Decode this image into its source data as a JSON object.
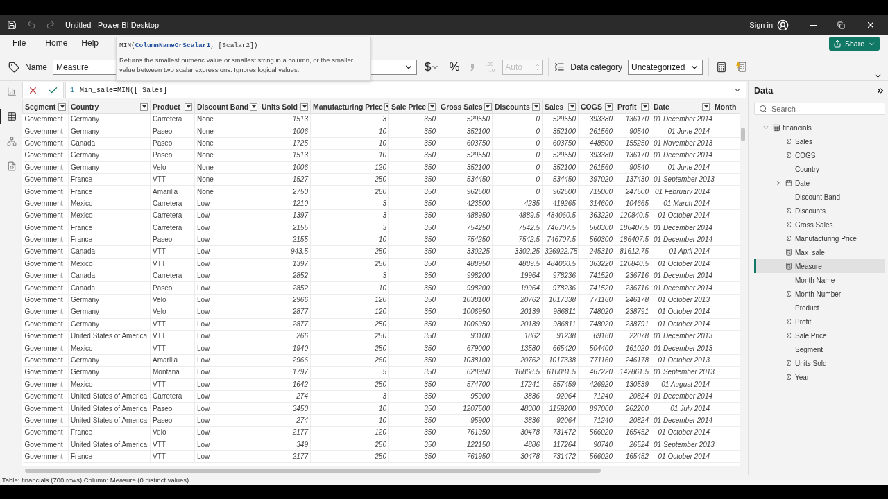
{
  "window": {
    "title": "Untitled - Power BI Desktop",
    "sign_in": "Sign in"
  },
  "ribbon_tabs": [
    {
      "label": "File",
      "selected": false
    },
    {
      "label": "Home",
      "selected": false
    },
    {
      "label": "Help",
      "selected": false
    }
  ],
  "share_button": "Share",
  "tooltip": {
    "signature": "MIN(**ColumnNameOrScalar1**, [Scalar2])",
    "description": "Returns the smallest numeric value or smallest string in a column, or the smaller value between two scalar expressions. Ignores logical values."
  },
  "toolbar": {
    "name_label": "Name",
    "name_value": "Measure",
    "format_buttons": [
      {
        "kind": "currency",
        "label": "$",
        "disabled": false
      },
      {
        "kind": "percent",
        "label": "%",
        "disabled": false
      },
      {
        "kind": "comma",
        "disabled": true
      },
      {
        "kind": "decimals",
        "label_top": ".00",
        "label_bottom": "→.0",
        "disabled": true
      }
    ],
    "decimal_places": {
      "value": "Auto",
      "disabled": true
    },
    "data_category_label": "Data category",
    "data_category_value": "Uncategorized"
  },
  "formula_bar": {
    "line_number": "1",
    "expression": "Min_sale=MIN([ Sales]"
  },
  "left_rail": [
    {
      "kind": "report",
      "selected": false
    },
    {
      "kind": "table",
      "selected": true
    },
    {
      "kind": "model",
      "selected": false
    },
    {
      "kind": "dax",
      "selected": false
    }
  ],
  "table": {
    "columns": [
      {
        "label": "Segment",
        "kind": "text"
      },
      {
        "label": "Country",
        "kind": "text"
      },
      {
        "label": "Product",
        "kind": "text"
      },
      {
        "label": "Discount Band",
        "kind": "text"
      },
      {
        "label": "Units Sold",
        "kind": "number"
      },
      {
        "label": "Manufacturing Price",
        "kind": "number"
      },
      {
        "label": "Sale Price",
        "kind": "number"
      },
      {
        "label": "Gross Sales",
        "kind": "number"
      },
      {
        "label": "Discounts",
        "kind": "number"
      },
      {
        "label": "Sales",
        "kind": "number"
      },
      {
        "label": "COGS",
        "kind": "number"
      },
      {
        "label": "Profit",
        "kind": "number"
      },
      {
        "label": "Date",
        "kind": "number"
      },
      {
        "label": "Month",
        "kind": "text"
      }
    ],
    "rows": [
      [
        "Government",
        "Germany",
        "Carretera",
        "None",
        "1513",
        "3",
        "350",
        "529550",
        "0",
        "529550",
        "393380",
        "136170",
        "01 December 2014"
      ],
      [
        "Government",
        "Germany",
        "Paseo",
        "None",
        "1006",
        "10",
        "350",
        "352100",
        "0",
        "352100",
        "261560",
        "90540",
        "01 June 2014"
      ],
      [
        "Government",
        "Canada",
        "Paseo",
        "None",
        "1725",
        "10",
        "350",
        "603750",
        "0",
        "603750",
        "448500",
        "155250",
        "01 November 2013"
      ],
      [
        "Government",
        "Germany",
        "Paseo",
        "None",
        "1513",
        "10",
        "350",
        "529550",
        "0",
        "529550",
        "393380",
        "136170",
        "01 December 2014"
      ],
      [
        "Government",
        "Germany",
        "Velo",
        "None",
        "1006",
        "120",
        "350",
        "352100",
        "0",
        "352100",
        "261560",
        "90540",
        "01 June 2014"
      ],
      [
        "Government",
        "France",
        "VTT",
        "None",
        "1527",
        "250",
        "350",
        "534450",
        "0",
        "534450",
        "397020",
        "137430",
        "01 September 2013"
      ],
      [
        "Government",
        "France",
        "Amarilla",
        "None",
        "2750",
        "260",
        "350",
        "962500",
        "0",
        "962500",
        "715000",
        "247500",
        "01 February 2014"
      ],
      [
        "Government",
        "Mexico",
        "Carretera",
        "Low",
        "1210",
        "3",
        "350",
        "423500",
        "4235",
        "419265",
        "314600",
        "104665",
        "01 March 2014"
      ],
      [
        "Government",
        "Mexico",
        "Carretera",
        "Low",
        "1397",
        "3",
        "350",
        "488950",
        "4889.5",
        "484060.5",
        "363220",
        "120840.5",
        "01 October 2014"
      ],
      [
        "Government",
        "France",
        "Carretera",
        "Low",
        "2155",
        "3",
        "350",
        "754250",
        "7542.5",
        "746707.5",
        "560300",
        "186407.5",
        "01 December 2014"
      ],
      [
        "Government",
        "France",
        "Paseo",
        "Low",
        "2155",
        "10",
        "350",
        "754250",
        "7542.5",
        "746707.5",
        "560300",
        "186407.5",
        "01 December 2014"
      ],
      [
        "Government",
        "Canada",
        "VTT",
        "Low",
        "943.5",
        "250",
        "350",
        "330225",
        "3302.25",
        "326922.75",
        "245310",
        "81612.75",
        "01 April 2014"
      ],
      [
        "Government",
        "Mexico",
        "VTT",
        "Low",
        "1397",
        "250",
        "350",
        "488950",
        "4889.5",
        "484060.5",
        "363220",
        "120840.5",
        "01 October 2014"
      ],
      [
        "Government",
        "Canada",
        "Carretera",
        "Low",
        "2852",
        "3",
        "350",
        "998200",
        "19964",
        "978236",
        "741520",
        "236716",
        "01 December 2014"
      ],
      [
        "Government",
        "Canada",
        "Paseo",
        "Low",
        "2852",
        "10",
        "350",
        "998200",
        "19964",
        "978236",
        "741520",
        "236716",
        "01 December 2014"
      ],
      [
        "Government",
        "Germany",
        "Velo",
        "Low",
        "2966",
        "120",
        "350",
        "1038100",
        "20762",
        "1017338",
        "771160",
        "246178",
        "01 October 2013"
      ],
      [
        "Government",
        "Germany",
        "Velo",
        "Low",
        "2877",
        "120",
        "350",
        "1006950",
        "20139",
        "986811",
        "748020",
        "238791",
        "01 October 2014"
      ],
      [
        "Government",
        "Germany",
        "VTT",
        "Low",
        "2877",
        "250",
        "350",
        "1006950",
        "20139",
        "986811",
        "748020",
        "238791",
        "01 October 2014"
      ],
      [
        "Government",
        "United States of America",
        "VTT",
        "Low",
        "266",
        "250",
        "350",
        "93100",
        "1862",
        "91238",
        "69160",
        "22078",
        "01 December 2013"
      ],
      [
        "Government",
        "Mexico",
        "VTT",
        "Low",
        "1940",
        "250",
        "350",
        "679000",
        "13580",
        "665420",
        "504400",
        "161020",
        "01 December 2013"
      ],
      [
        "Government",
        "Germany",
        "Amarilla",
        "Low",
        "2966",
        "260",
        "350",
        "1038100",
        "20762",
        "1017338",
        "771160",
        "246178",
        "01 October 2013"
      ],
      [
        "Government",
        "Germany",
        "Montana",
        "Low",
        "1797",
        "5",
        "350",
        "628950",
        "18868.5",
        "610081.5",
        "467220",
        "142861.5",
        "01 September 2013"
      ],
      [
        "Government",
        "Mexico",
        "VTT",
        "Low",
        "1642",
        "250",
        "350",
        "574700",
        "17241",
        "557459",
        "426920",
        "130539",
        "01 August 2014"
      ],
      [
        "Government",
        "United States of America",
        "Carretera",
        "Low",
        "274",
        "3",
        "350",
        "95900",
        "3836",
        "92064",
        "71240",
        "20824",
        "01 December 2014"
      ],
      [
        "Government",
        "United States of America",
        "Paseo",
        "Low",
        "3450",
        "10",
        "350",
        "1207500",
        "48300",
        "1159200",
        "897000",
        "262200",
        "01 July 2014"
      ],
      [
        "Government",
        "United States of America",
        "Paseo",
        "Low",
        "274",
        "10",
        "350",
        "95900",
        "3836",
        "92064",
        "71240",
        "20824",
        "01 December 2014"
      ],
      [
        "Government",
        "France",
        "Velo",
        "Low",
        "2177",
        "120",
        "350",
        "761950",
        "30478",
        "731472",
        "566020",
        "165452",
        "01 October 2014"
      ],
      [
        "Government",
        "United States of America",
        "VTT",
        "Low",
        "349",
        "250",
        "350",
        "122150",
        "4886",
        "117264",
        "90740",
        "26524",
        "01 September 2013"
      ],
      [
        "Government",
        "France",
        "VTT",
        "Low",
        "2177",
        "250",
        "350",
        "761950",
        "30478",
        "731472",
        "566020",
        "165452",
        "01 October 2014"
      ]
    ]
  },
  "data_pane": {
    "title": "Data",
    "search": {
      "placeholder": "Search"
    },
    "tree": [
      {
        "label": "financials",
        "kind": "table",
        "expanded": true,
        "selected": false,
        "children": [
          {
            "label": "Sales",
            "kind": "sum",
            "selected": false
          },
          {
            "label": "COGS",
            "kind": "sum",
            "selected": false
          },
          {
            "label": "Country",
            "kind": "text",
            "selected": false
          },
          {
            "label": "Date",
            "kind": "date",
            "expanded": false,
            "selected": false
          },
          {
            "label": "Discount Band",
            "kind": "text",
            "selected": false
          },
          {
            "label": "Discounts",
            "kind": "sum",
            "selected": false
          },
          {
            "label": "Gross Sales",
            "kind": "sum",
            "selected": false
          },
          {
            "label": "Manufacturing Price",
            "kind": "sum",
            "selected": false
          },
          {
            "label": "Max_sale",
            "kind": "measure",
            "selected": false
          },
          {
            "label": "Measure",
            "kind": "measure",
            "selected": true
          },
          {
            "label": "Month Name",
            "kind": "text",
            "selected": false
          },
          {
            "label": "Month Number",
            "kind": "sum",
            "selected": false
          },
          {
            "label": "Product",
            "kind": "text",
            "selected": false
          },
          {
            "label": "Profit",
            "kind": "sum",
            "selected": false
          },
          {
            "label": "Sale Price",
            "kind": "sum",
            "selected": false
          },
          {
            "label": "Segment",
            "kind": "text",
            "selected": false
          },
          {
            "label": "Units Sold",
            "kind": "sum",
            "selected": false
          },
          {
            "label": "Year",
            "kind": "sum",
            "selected": false
          }
        ]
      }
    ]
  },
  "status_bar": "Table: financials (700 rows) Column: Measure (0 distinct values)"
}
